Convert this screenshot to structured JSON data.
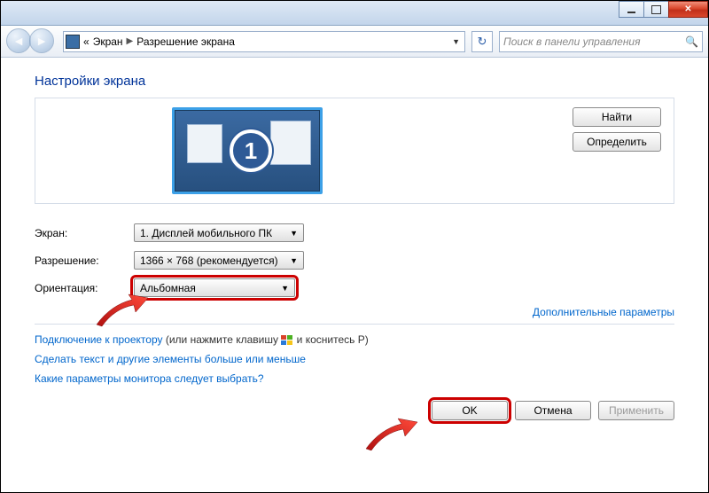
{
  "titlebar": {},
  "nav": {
    "crumb_prefix": "«",
    "crumb1": "Экран",
    "crumb2": "Разрешение экрана",
    "search_placeholder": "Поиск в панели управления"
  },
  "heading": "Настройки экрана",
  "preview": {
    "monitor_number": "1"
  },
  "side": {
    "find": "Найти",
    "detect": "Определить"
  },
  "form": {
    "display_label": "Экран:",
    "display_value": "1. Дисплей мобильного ПК",
    "resolution_label": "Разрешение:",
    "resolution_value": "1366 × 768 (рекомендуется)",
    "orientation_label": "Ориентация:",
    "orientation_value": "Альбомная"
  },
  "advanced_link": "Дополнительные параметры",
  "links": {
    "projector_link": "Подключение к проектору",
    "projector_rest_a": " (или нажмите клавишу ",
    "projector_rest_b": " и коснитесь P)",
    "textsize": "Сделать текст и другие элементы больше или меньше",
    "which_monitor": "Какие параметры монитора следует выбрать?"
  },
  "footer": {
    "ok": "OK",
    "cancel": "Отмена",
    "apply": "Применить"
  }
}
